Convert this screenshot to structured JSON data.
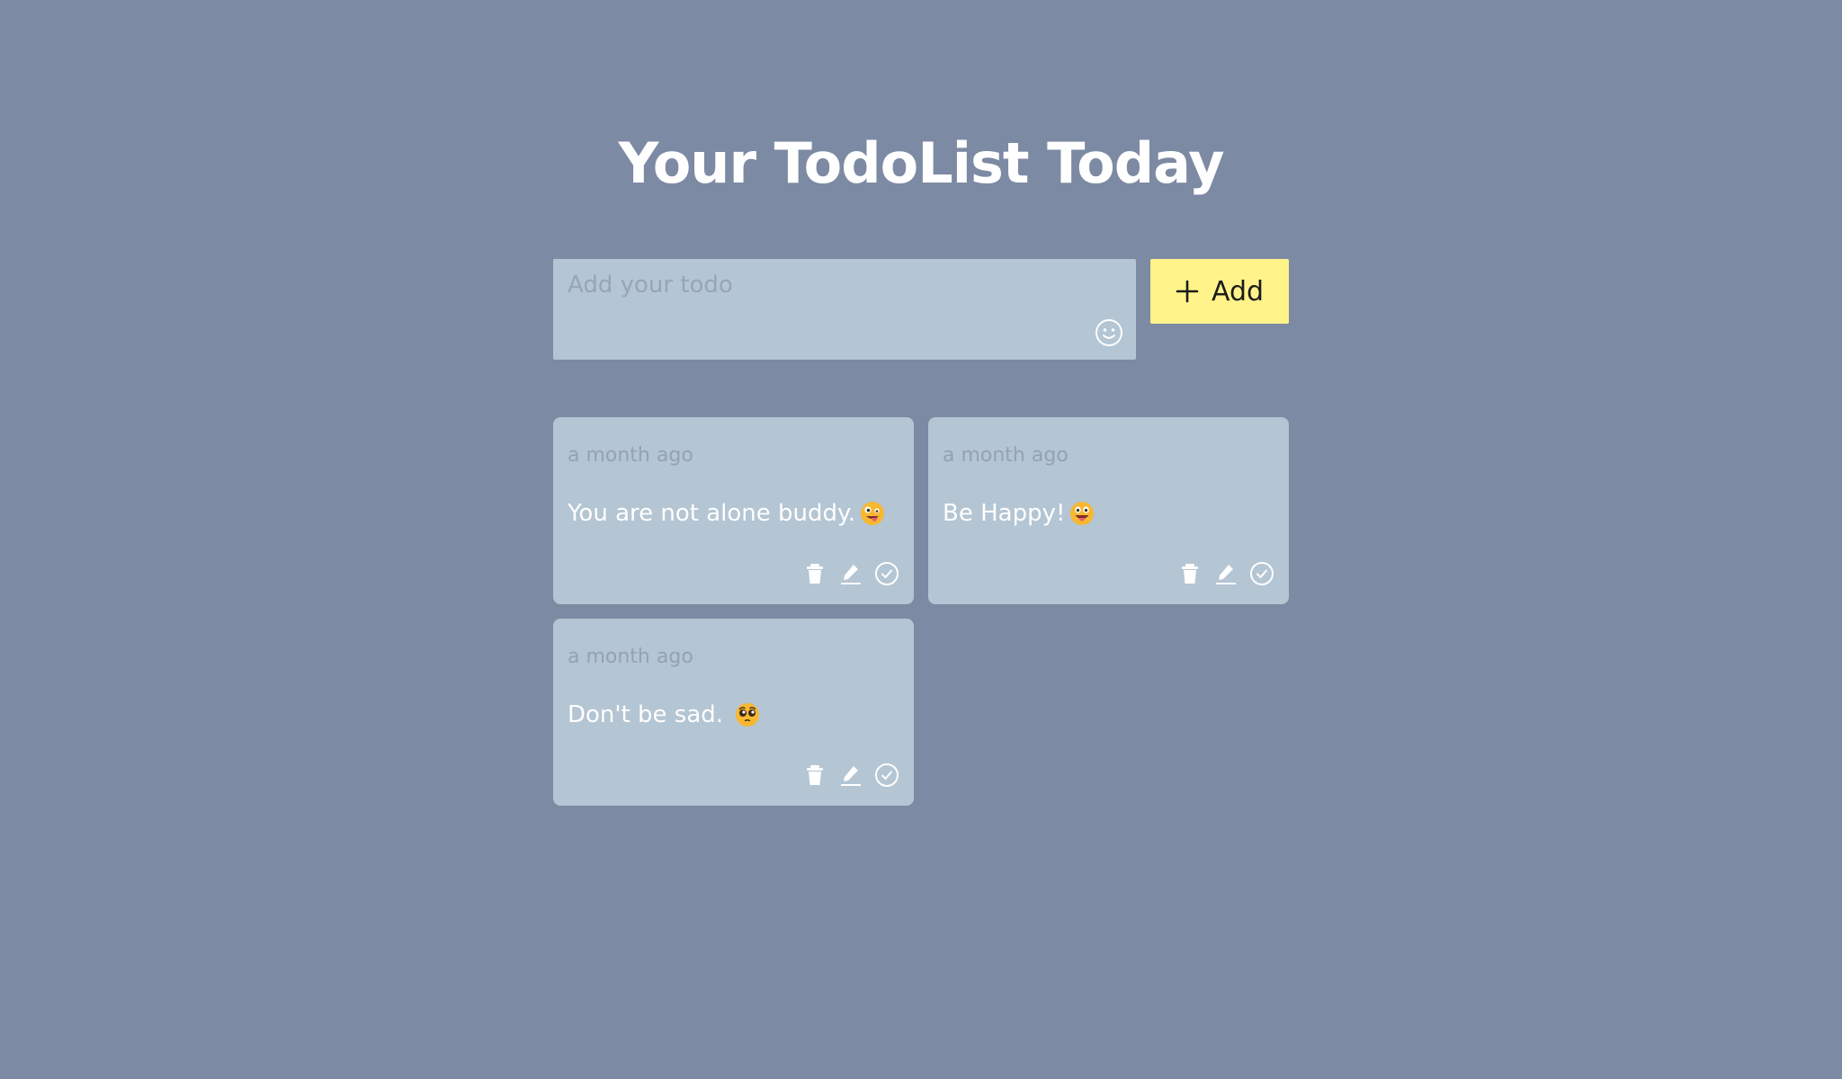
{
  "header": {
    "title": "Your TodoList Today"
  },
  "input": {
    "placeholder": "Add your todo",
    "value": ""
  },
  "add_button": {
    "label": "Add"
  },
  "colors": {
    "background": "#7d8aa3",
    "card": "#b4c5d3",
    "accent": "#fff38a"
  },
  "todos": [
    {
      "timestamp": "a month ago",
      "text": "You are not alone buddy.",
      "emoji": "zany-face"
    },
    {
      "timestamp": "a month ago",
      "text": "Be Happy!",
      "emoji": "grinning-tongue-face"
    },
    {
      "timestamp": "a month ago",
      "text": "Don't be sad.",
      "emoji": "pleading-face"
    }
  ]
}
